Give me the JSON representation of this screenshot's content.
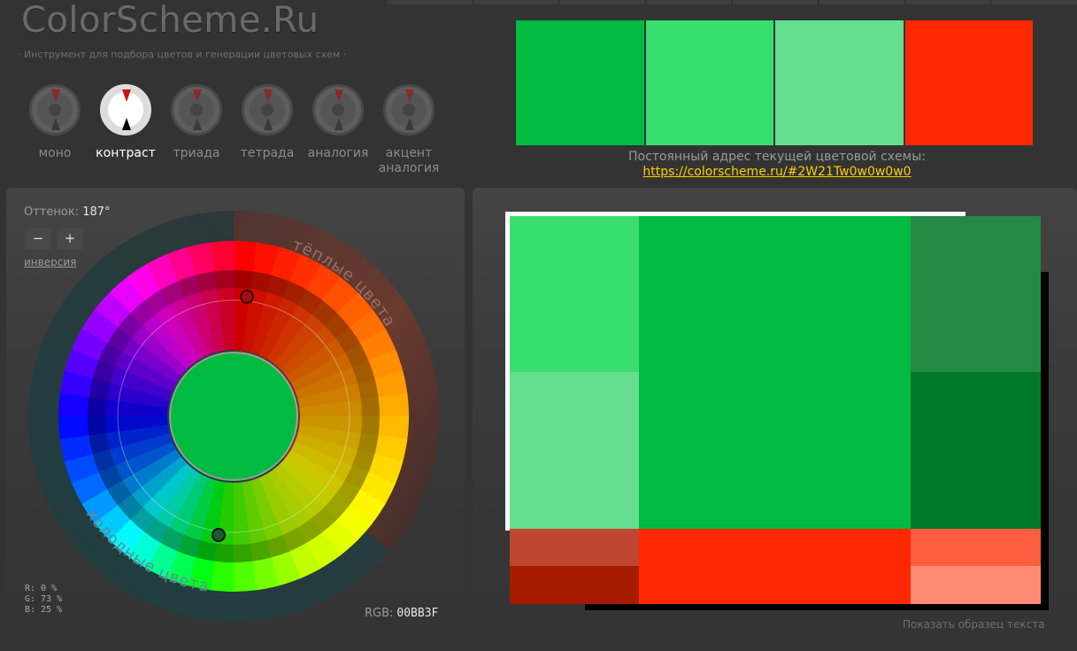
{
  "header": {
    "logo": "ColorScheme.Ru",
    "tagline": "· Инструмент для подбора цветов и генерации цветовых схем ·"
  },
  "modes": [
    {
      "label": "моно",
      "icon": "mono-scheme-icon",
      "active": false
    },
    {
      "label": "контраст",
      "icon": "contrast-scheme-icon",
      "active": true
    },
    {
      "label": "триада",
      "icon": "triad-scheme-icon",
      "active": false
    },
    {
      "label": "тетрада",
      "icon": "tetrad-scheme-icon",
      "active": false
    },
    {
      "label": "аналогия",
      "icon": "analogy-scheme-icon",
      "active": false
    },
    {
      "label": "акцент аналогия",
      "icon": "accent-analogy-scheme-icon",
      "active": false
    }
  ],
  "palette": {
    "colors": [
      "#00BB3F",
      "#38DF70",
      "#66DE8F",
      "#FF2800"
    ],
    "permalink_label": "Постоянный адрес текущей цветовой схемы:",
    "permalink_url": "https://colorscheme.ru/#2W21Tw0w0w0w0"
  },
  "controls": {
    "hue_label": "Оттенок:",
    "hue_value": "187°",
    "minus": "−",
    "plus": "+",
    "inversion": "инверсия"
  },
  "wheel": {
    "warm_label": "тёплые цвета",
    "cold_label": "холодные цвета",
    "center_color": "#00BB3F"
  },
  "rgb": {
    "r": "R:  0 %",
    "g": "G: 73 %",
    "b": "B: 25 %",
    "hex_label": "RGB:",
    "hex_value": "00BB3F"
  },
  "preview": {
    "colors": {
      "main": "#00BB3F",
      "main_light": "#38DF70",
      "main_lighter": "#66DE8F",
      "main_dark": "#238A45",
      "main_darker": "#007A29",
      "accent": "#FF2800",
      "accent_dark": "#BF4630",
      "accent_darker": "#A61A00",
      "accent_light": "#FF5D40",
      "accent_lighter": "#FF8A73"
    },
    "show_sample": "Показать образец текста"
  }
}
